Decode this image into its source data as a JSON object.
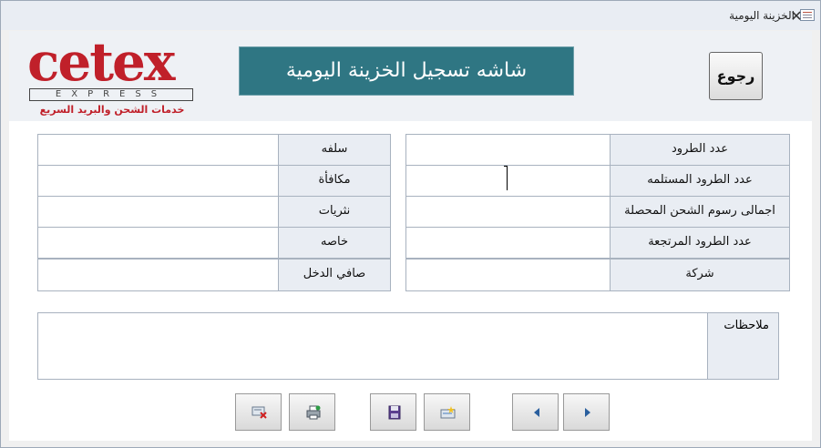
{
  "window": {
    "title": "الخزينة اليومية",
    "close_glyph": "✕"
  },
  "header": {
    "logo": {
      "word": "cetex",
      "sub": "EXPRESS",
      "tagline": "خدمات الشحن والبريد السريع"
    },
    "banner_title": "شاشه تسجيل الخزينة اليومية",
    "back_label": "رجوع"
  },
  "right_fields": [
    {
      "label": "عدد الطرود",
      "value": ""
    },
    {
      "label": "عدد الطرود المستلمه",
      "value": ""
    },
    {
      "label": "اجمالى رسوم الشحن المحصلة",
      "value": ""
    },
    {
      "label": "عدد الطرود المرتجعة",
      "value": ""
    },
    {
      "label": "شركة",
      "value": ""
    }
  ],
  "left_fields": [
    {
      "label": "سلفه",
      "value": ""
    },
    {
      "label": "مكافأة",
      "value": ""
    },
    {
      "label": "نثريات",
      "value": ""
    },
    {
      "label": "خاصه",
      "value": ""
    },
    {
      "label": "صافي الدخل",
      "value": ""
    }
  ],
  "notes": {
    "label": "ملاحظات",
    "value": ""
  },
  "toolbar": {
    "buttons": [
      {
        "icon": "cancel-icon"
      },
      {
        "icon": "print-icon"
      },
      {
        "icon": "save-icon"
      },
      {
        "icon": "new-record-icon"
      },
      {
        "icon": "previous-record-icon"
      },
      {
        "icon": "next-record-icon"
      }
    ]
  },
  "colors": {
    "banner": "#2f7683",
    "brand_red": "#c0202a",
    "label_bg": "#e9edf3"
  }
}
